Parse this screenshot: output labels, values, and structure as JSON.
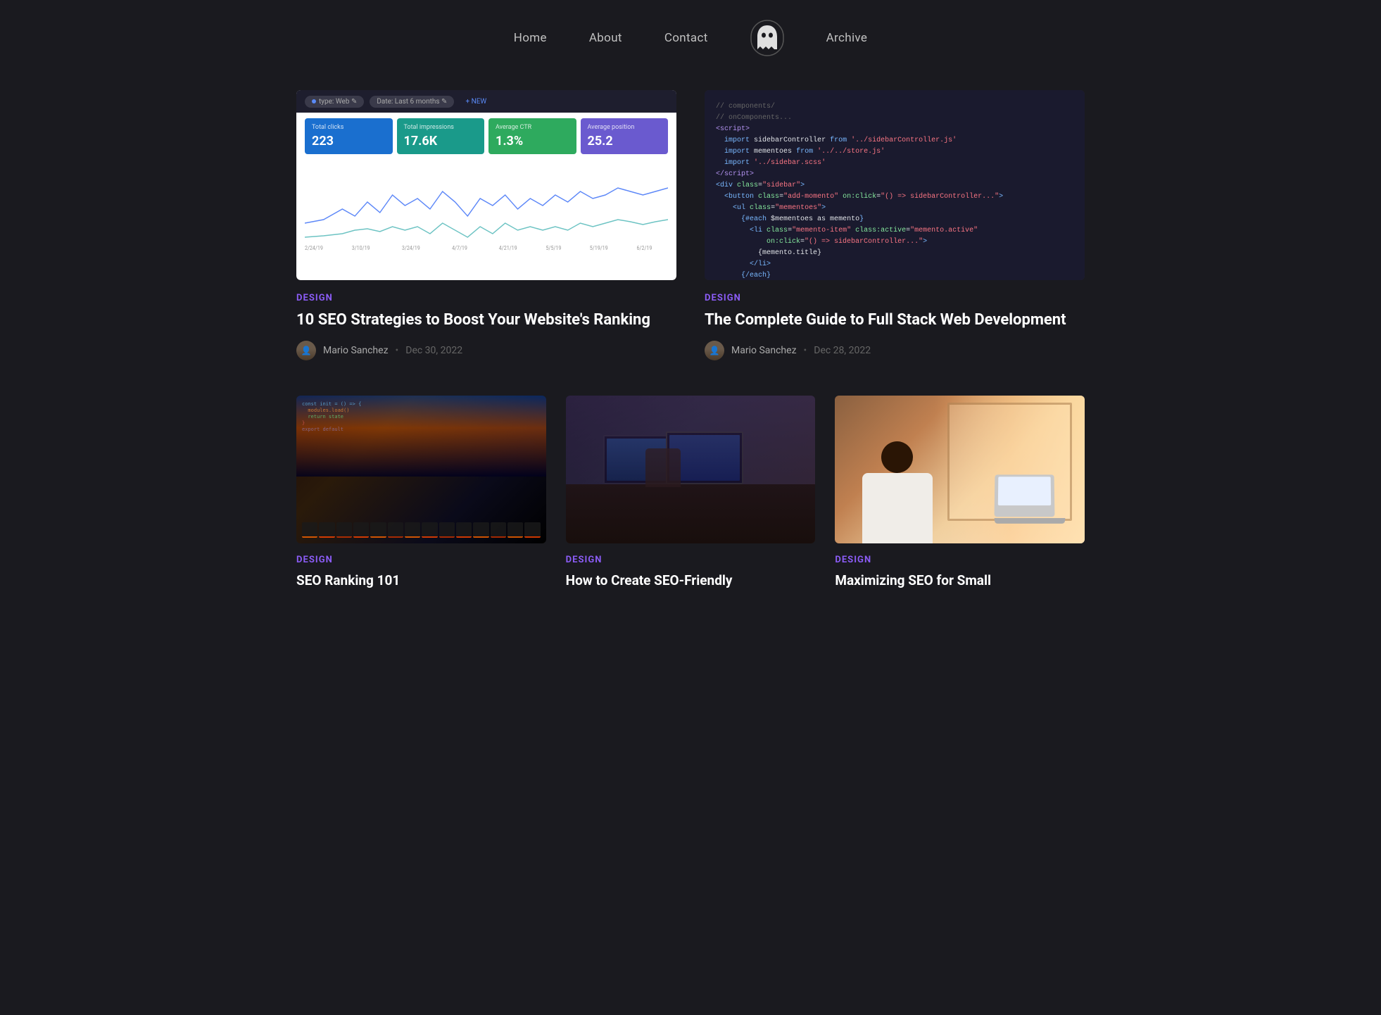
{
  "nav": {
    "links": [
      {
        "id": "home",
        "label": "Home"
      },
      {
        "id": "about",
        "label": "About"
      },
      {
        "id": "contact",
        "label": "Contact"
      },
      {
        "id": "archive",
        "label": "Archive"
      }
    ]
  },
  "featured": [
    {
      "id": "post-1",
      "category": "DESIGN",
      "title": "10 SEO Strategies to Boost Your Website's Ranking",
      "author": "Mario Sanchez",
      "date": "Dec 30, 2022",
      "image_type": "analytics"
    },
    {
      "id": "post-2",
      "category": "DESIGN",
      "title": "The Complete Guide to Full Stack Web Development",
      "author": "Mario Sanchez",
      "date": "Dec 28, 2022",
      "image_type": "code"
    }
  ],
  "posts": [
    {
      "id": "post-3",
      "category": "DESIGN",
      "title": "SEO Ranking 101",
      "image_type": "keyboard"
    },
    {
      "id": "post-4",
      "category": "DESIGN",
      "title": "How to Create SEO-Friendly",
      "image_type": "office"
    },
    {
      "id": "post-5",
      "category": "DESIGN",
      "title": "Maximizing SEO for Small",
      "image_type": "bright-office"
    }
  ],
  "stats": [
    {
      "label": "Total clicks",
      "value": "223",
      "color": "blue"
    },
    {
      "label": "Total impressions",
      "value": "17.6K",
      "color": "teal"
    },
    {
      "label": "Average CTR",
      "value": "1.3%",
      "color": "green"
    },
    {
      "label": "Average position",
      "value": "25.2",
      "color": "purple"
    }
  ]
}
